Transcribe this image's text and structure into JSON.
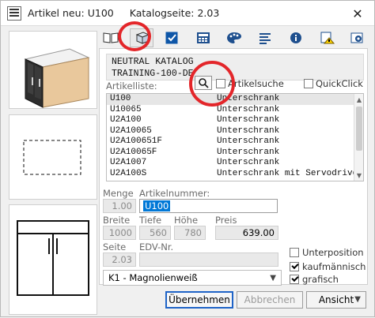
{
  "titlebar": {
    "title_left": "Artikel neu: U100",
    "title_right": "Katalogseite: 2.03",
    "close_glyph": "✕"
  },
  "toolbar": {
    "buttons": [
      {
        "name": "catalog-book-icon"
      },
      {
        "name": "cube-icon"
      },
      {
        "name": "checkbox-icon"
      },
      {
        "name": "calculator-icon"
      },
      {
        "name": "palette-icon"
      },
      {
        "name": "text-lines-icon"
      },
      {
        "name": "info-icon"
      },
      {
        "name": "warning-icon"
      },
      {
        "name": "settings-box-icon"
      }
    ],
    "active_index": 1
  },
  "catalog": {
    "line1": "NEUTRAL KATALOG",
    "line2": "TRAINING-100-DE"
  },
  "labels": {
    "artikelliste": "Artikelliste:",
    "artikelsuche": "Artikelsuche",
    "quickclick": "QuickClick",
    "menge": "Menge",
    "artikelnummer": "Artikelnummer:",
    "breite": "Breite",
    "tiefe": "Tiefe",
    "hoehe": "Höhe",
    "preis": "Preis",
    "seite": "Seite",
    "edv": "EDV-Nr.",
    "unterposition": "Unterposition",
    "kaufmaennisch": "kaufmännisch",
    "grafisch": "grafisch"
  },
  "list": {
    "rows": [
      {
        "code": "U100",
        "desc": "Unterschrank"
      },
      {
        "code": "U10065",
        "desc": "Unterschrank"
      },
      {
        "code": "U2A100",
        "desc": "Unterschrank"
      },
      {
        "code": "U2A10065",
        "desc": "Unterschrank"
      },
      {
        "code": "U2A100651F",
        "desc": "Unterschrank"
      },
      {
        "code": "U2A10065F",
        "desc": "Unterschrank"
      },
      {
        "code": "U2A1007",
        "desc": "Unterschrank"
      },
      {
        "code": "U2A100S",
        "desc": "Unterschrank mit Servodrive"
      }
    ],
    "selected_index": 0
  },
  "fields": {
    "menge_value": "1.00",
    "artikelnummer_value": "U100",
    "breite_value": "1000",
    "tiefe_value": "560",
    "hoehe_value": "780",
    "preis_value": "639.00",
    "seite_value": "2.03",
    "edv_value": ""
  },
  "checkboxes": {
    "artikelsuche": false,
    "quickclick": false,
    "unterposition": false,
    "kaufmaennisch": true,
    "grafisch": true
  },
  "dropdown": {
    "value": "K1 - Magnolienweiß"
  },
  "buttons": {
    "uebernehmen": "Übernehmen",
    "abbrechen": "Abbrechen",
    "ansicht": "Ansicht"
  },
  "colors": {
    "accent": "#1e63c7",
    "selection": "#0078d7",
    "annotation": "#e3262a"
  }
}
